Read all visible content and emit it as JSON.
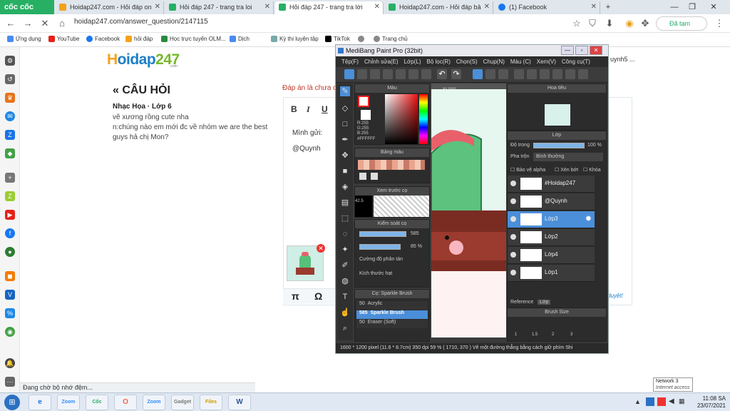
{
  "browser": {
    "brand": "cốc cốc",
    "tabs": [
      {
        "label": "Hoidap247.com - Hỏi đáp on",
        "icon_color": "#f4a21b"
      },
      {
        "label": "Hỏi đáp 247 - trang tra loi",
        "icon_color": "#27b064"
      },
      {
        "label": "Hỏi đáp 247 - trang tra lời",
        "icon_color": "#27b064"
      },
      {
        "label": "Hoidap247.com - Hỏi đáp bả",
        "icon_color": "#27b064"
      },
      {
        "label": "(1) Facebook",
        "icon_color": "#1877f2"
      }
    ],
    "new_tab": "+",
    "url": "hoidap247.com/answer_question/2147115",
    "sync_button": "Đã tạm dừng",
    "bookmarks": [
      {
        "label": "Ứng dụng",
        "icon_color": "#4a8af4"
      },
      {
        "label": "YouTube",
        "icon_color": "#e62117"
      },
      {
        "label": "Facebook",
        "icon_color": "#1877f2"
      },
      {
        "label": "hỏi đáp",
        "icon_color": "#f4a21b"
      },
      {
        "label": "Học trực tuyến OLM...",
        "icon_color": "#2b8a3e"
      },
      {
        "label": "Dịch",
        "icon_color": "#4a8af4"
      },
      {
        "label": "Kỳ thi luyện tập",
        "icon_color": "#7aa"
      },
      {
        "label": "TikTok",
        "icon_color": "#000000"
      },
      {
        "label": "Trang chủ",
        "icon_color": "#888888"
      },
      {
        "label": "Trang chủ",
        "icon_color": "#888888"
      }
    ],
    "status_text": "Đang chờ bộ nhớ đệm..."
  },
  "page": {
    "logo": {
      "part1": "H",
      "part2": "oidap",
      "part3": "247",
      "sub": ".com"
    },
    "question_heading": "« CÂU HỎI",
    "subject": "Nhạc Họa · Lớp 6",
    "question_text": "vẽ xương rồng cute nha\nn:chúng nào em mới đc về nhóm we are the best guys hả chị Mon?",
    "answer_notice": "Đáp án là chưa đ",
    "editor_text_line1": "Mình gửi:",
    "editor_text_line2": "@Quynh",
    "duyet_text": "duyệt!",
    "user_fragment": "uynh5 ..."
  },
  "medibang": {
    "title": "MediBang Paint Pro (32bit)",
    "menu": [
      "Tệp(F)",
      "Chỉnh sửa(E)",
      "Lớp(L)",
      "Bộ lọc(R)",
      "Chọn(S)",
      "Chụp(N)",
      "Màu (C)",
      "Xem(V)",
      "Công cụ(T)"
    ],
    "color_panel_title": "Màu",
    "rgb_text": "R:255\nG:255\nB:255",
    "hex": "#FFFFFF",
    "palette_title": "Bảng màu",
    "preview_title": "Xem trước cọ",
    "preview_value": "42.5",
    "brush_control_title": "Kiểm soát cọ",
    "brush_size": "585",
    "brush_opacity": "85 %",
    "spread_label": "Cường độ phân tán",
    "particle_label": "Kích thước hạt",
    "brush_list_title": "Cọ: Sparkle Brush",
    "brushes": [
      {
        "size": "50",
        "name": "Acrylic"
      },
      {
        "size": "585",
        "name": "Sparkle Brush"
      },
      {
        "size": "50",
        "name": "Eraser (Soft)"
      }
    ],
    "canvas_tab": "xu.png",
    "navigator_title": "Hoa tiêu",
    "layer_title": "Lớp",
    "opacity_label": "Độ trong",
    "opacity_value": "100 %",
    "blend_label": "Pha trộn",
    "blend_value": "Bình thường",
    "protect_alpha": "Bảo vệ alpha",
    "clip": "Xén bớt",
    "lock": "Khóa",
    "layers": [
      {
        "name": "#Hoidap247",
        "selected": false
      },
      {
        "name": "@Quynh",
        "selected": false
      },
      {
        "name": "Lớp3",
        "selected": true
      },
      {
        "name": "Lớp2",
        "selected": false
      },
      {
        "name": "Lớp4",
        "selected": false
      },
      {
        "name": "Lớp1",
        "selected": false
      }
    ],
    "tab_reference": "Reference",
    "tab_layer": "Lớp",
    "brush_size_title": "Brush Size",
    "brush_sizes": [
      "1",
      "1.5",
      "2",
      "3"
    ],
    "status": "1600 * 1200 pixel   (11.6 * 8.7cm)   350 dpi   59 %   ( 1710, 370 )   Vẽ một đường thẳng bằng cách giữ phím Shi"
  },
  "taskbar": {
    "apps": [
      "e",
      "Zoom",
      "Cốc",
      "O",
      "Zoom",
      "Gadget",
      "Files",
      "W"
    ],
    "time": "11:08 SA",
    "date": "23/07/2021",
    "network_title": "Network  3",
    "network_status": "Internet access"
  }
}
